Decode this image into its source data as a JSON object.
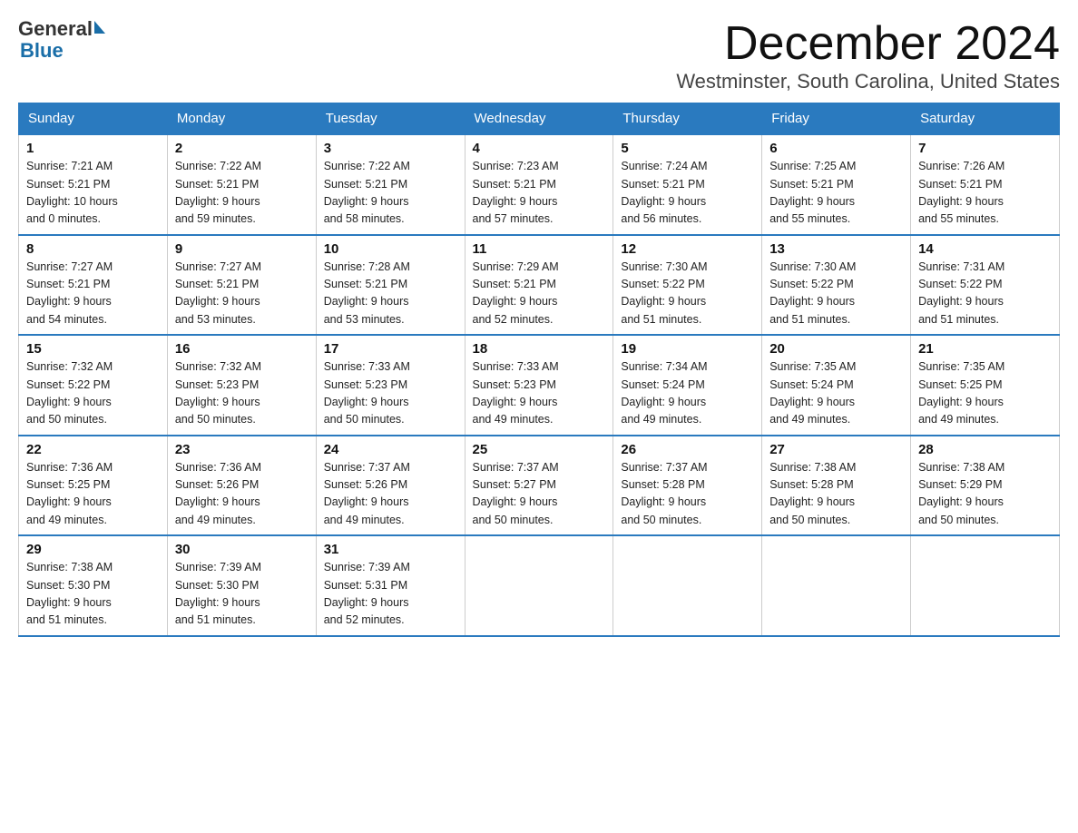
{
  "header": {
    "logo_general": "General",
    "logo_blue": "Blue",
    "month_title": "December 2024",
    "location": "Westminster, South Carolina, United States"
  },
  "days_of_week": [
    "Sunday",
    "Monday",
    "Tuesday",
    "Wednesday",
    "Thursday",
    "Friday",
    "Saturday"
  ],
  "weeks": [
    [
      {
        "day": "1",
        "sunrise": "7:21 AM",
        "sunset": "5:21 PM",
        "daylight": "10 hours and 0 minutes."
      },
      {
        "day": "2",
        "sunrise": "7:22 AM",
        "sunset": "5:21 PM",
        "daylight": "9 hours and 59 minutes."
      },
      {
        "day": "3",
        "sunrise": "7:22 AM",
        "sunset": "5:21 PM",
        "daylight": "9 hours and 58 minutes."
      },
      {
        "day": "4",
        "sunrise": "7:23 AM",
        "sunset": "5:21 PM",
        "daylight": "9 hours and 57 minutes."
      },
      {
        "day": "5",
        "sunrise": "7:24 AM",
        "sunset": "5:21 PM",
        "daylight": "9 hours and 56 minutes."
      },
      {
        "day": "6",
        "sunrise": "7:25 AM",
        "sunset": "5:21 PM",
        "daylight": "9 hours and 55 minutes."
      },
      {
        "day": "7",
        "sunrise": "7:26 AM",
        "sunset": "5:21 PM",
        "daylight": "9 hours and 55 minutes."
      }
    ],
    [
      {
        "day": "8",
        "sunrise": "7:27 AM",
        "sunset": "5:21 PM",
        "daylight": "9 hours and 54 minutes."
      },
      {
        "day": "9",
        "sunrise": "7:27 AM",
        "sunset": "5:21 PM",
        "daylight": "9 hours and 53 minutes."
      },
      {
        "day": "10",
        "sunrise": "7:28 AM",
        "sunset": "5:21 PM",
        "daylight": "9 hours and 53 minutes."
      },
      {
        "day": "11",
        "sunrise": "7:29 AM",
        "sunset": "5:21 PM",
        "daylight": "9 hours and 52 minutes."
      },
      {
        "day": "12",
        "sunrise": "7:30 AM",
        "sunset": "5:22 PM",
        "daylight": "9 hours and 51 minutes."
      },
      {
        "day": "13",
        "sunrise": "7:30 AM",
        "sunset": "5:22 PM",
        "daylight": "9 hours and 51 minutes."
      },
      {
        "day": "14",
        "sunrise": "7:31 AM",
        "sunset": "5:22 PM",
        "daylight": "9 hours and 51 minutes."
      }
    ],
    [
      {
        "day": "15",
        "sunrise": "7:32 AM",
        "sunset": "5:22 PM",
        "daylight": "9 hours and 50 minutes."
      },
      {
        "day": "16",
        "sunrise": "7:32 AM",
        "sunset": "5:23 PM",
        "daylight": "9 hours and 50 minutes."
      },
      {
        "day": "17",
        "sunrise": "7:33 AM",
        "sunset": "5:23 PM",
        "daylight": "9 hours and 50 minutes."
      },
      {
        "day": "18",
        "sunrise": "7:33 AM",
        "sunset": "5:23 PM",
        "daylight": "9 hours and 49 minutes."
      },
      {
        "day": "19",
        "sunrise": "7:34 AM",
        "sunset": "5:24 PM",
        "daylight": "9 hours and 49 minutes."
      },
      {
        "day": "20",
        "sunrise": "7:35 AM",
        "sunset": "5:24 PM",
        "daylight": "9 hours and 49 minutes."
      },
      {
        "day": "21",
        "sunrise": "7:35 AM",
        "sunset": "5:25 PM",
        "daylight": "9 hours and 49 minutes."
      }
    ],
    [
      {
        "day": "22",
        "sunrise": "7:36 AM",
        "sunset": "5:25 PM",
        "daylight": "9 hours and 49 minutes."
      },
      {
        "day": "23",
        "sunrise": "7:36 AM",
        "sunset": "5:26 PM",
        "daylight": "9 hours and 49 minutes."
      },
      {
        "day": "24",
        "sunrise": "7:37 AM",
        "sunset": "5:26 PM",
        "daylight": "9 hours and 49 minutes."
      },
      {
        "day": "25",
        "sunrise": "7:37 AM",
        "sunset": "5:27 PM",
        "daylight": "9 hours and 50 minutes."
      },
      {
        "day": "26",
        "sunrise": "7:37 AM",
        "sunset": "5:28 PM",
        "daylight": "9 hours and 50 minutes."
      },
      {
        "day": "27",
        "sunrise": "7:38 AM",
        "sunset": "5:28 PM",
        "daylight": "9 hours and 50 minutes."
      },
      {
        "day": "28",
        "sunrise": "7:38 AM",
        "sunset": "5:29 PM",
        "daylight": "9 hours and 50 minutes."
      }
    ],
    [
      {
        "day": "29",
        "sunrise": "7:38 AM",
        "sunset": "5:30 PM",
        "daylight": "9 hours and 51 minutes."
      },
      {
        "day": "30",
        "sunrise": "7:39 AM",
        "sunset": "5:30 PM",
        "daylight": "9 hours and 51 minutes."
      },
      {
        "day": "31",
        "sunrise": "7:39 AM",
        "sunset": "5:31 PM",
        "daylight": "9 hours and 52 minutes."
      },
      null,
      null,
      null,
      null
    ]
  ],
  "labels": {
    "sunrise": "Sunrise:",
    "sunset": "Sunset:",
    "daylight": "Daylight:"
  }
}
